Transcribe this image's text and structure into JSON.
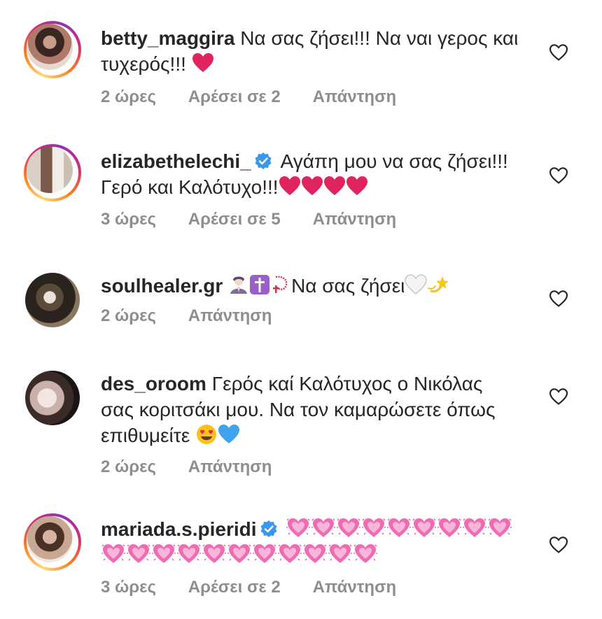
{
  "comments": [
    {
      "username": "betty_maggira",
      "text": "Να σας ζήσει!!! Να ναι γερος και τυχερός!!!",
      "emojis": [
        "red-heart"
      ],
      "time": "2 ώρες",
      "likes": "Αρέσει σε 2",
      "reply": "Απάντηση",
      "verified": false,
      "story_ring": true
    },
    {
      "username": "elizabethelechi_",
      "text": "Αγάπη μου να σας ζήσει!!!Γερό και Καλότυχο!!!",
      "emojis": [
        "red-heart",
        "red-heart",
        "red-heart",
        "red-heart"
      ],
      "time": "3 ώρες",
      "likes": "Αρέσει σε 5",
      "reply": "Απάντηση",
      "verified": true,
      "story_ring": true
    },
    {
      "username": "soulhealer.gr",
      "text_pre_emojis": [
        "person-praying",
        "latin-cross",
        "rosary"
      ],
      "text": "Να σας ζήσει",
      "emojis": [
        "white-heart",
        "dizzy"
      ],
      "time": "2 ώρες",
      "reply": "Απάντηση",
      "verified": false,
      "story_ring": false
    },
    {
      "username": "des_oroom",
      "text": "Γερός καί Καλότυχος ο Νικόλας σας κοριτσάκι μου. Να τον καμαρώσετε όπως επιθυμείτε",
      "emojis": [
        "heart-eyes",
        "blue-heart"
      ],
      "time": "2 ώρες",
      "reply": "Απάντηση",
      "verified": false,
      "story_ring": false
    },
    {
      "username": "mariada.s.pieridi",
      "text": "",
      "emojis": [
        "sparkling-heart x 20"
      ],
      "time": "3 ώρες",
      "likes": "Αρέσει σε 2",
      "reply": "Απάντηση",
      "verified": true,
      "story_ring": true
    }
  ],
  "colors": {
    "text": "#262626",
    "meta": "#8e8e8e",
    "verified": "#3897f0",
    "red_heart": "#e0245e",
    "pink_heart": "#f06cb2",
    "blue_heart": "#3fa3ef"
  }
}
